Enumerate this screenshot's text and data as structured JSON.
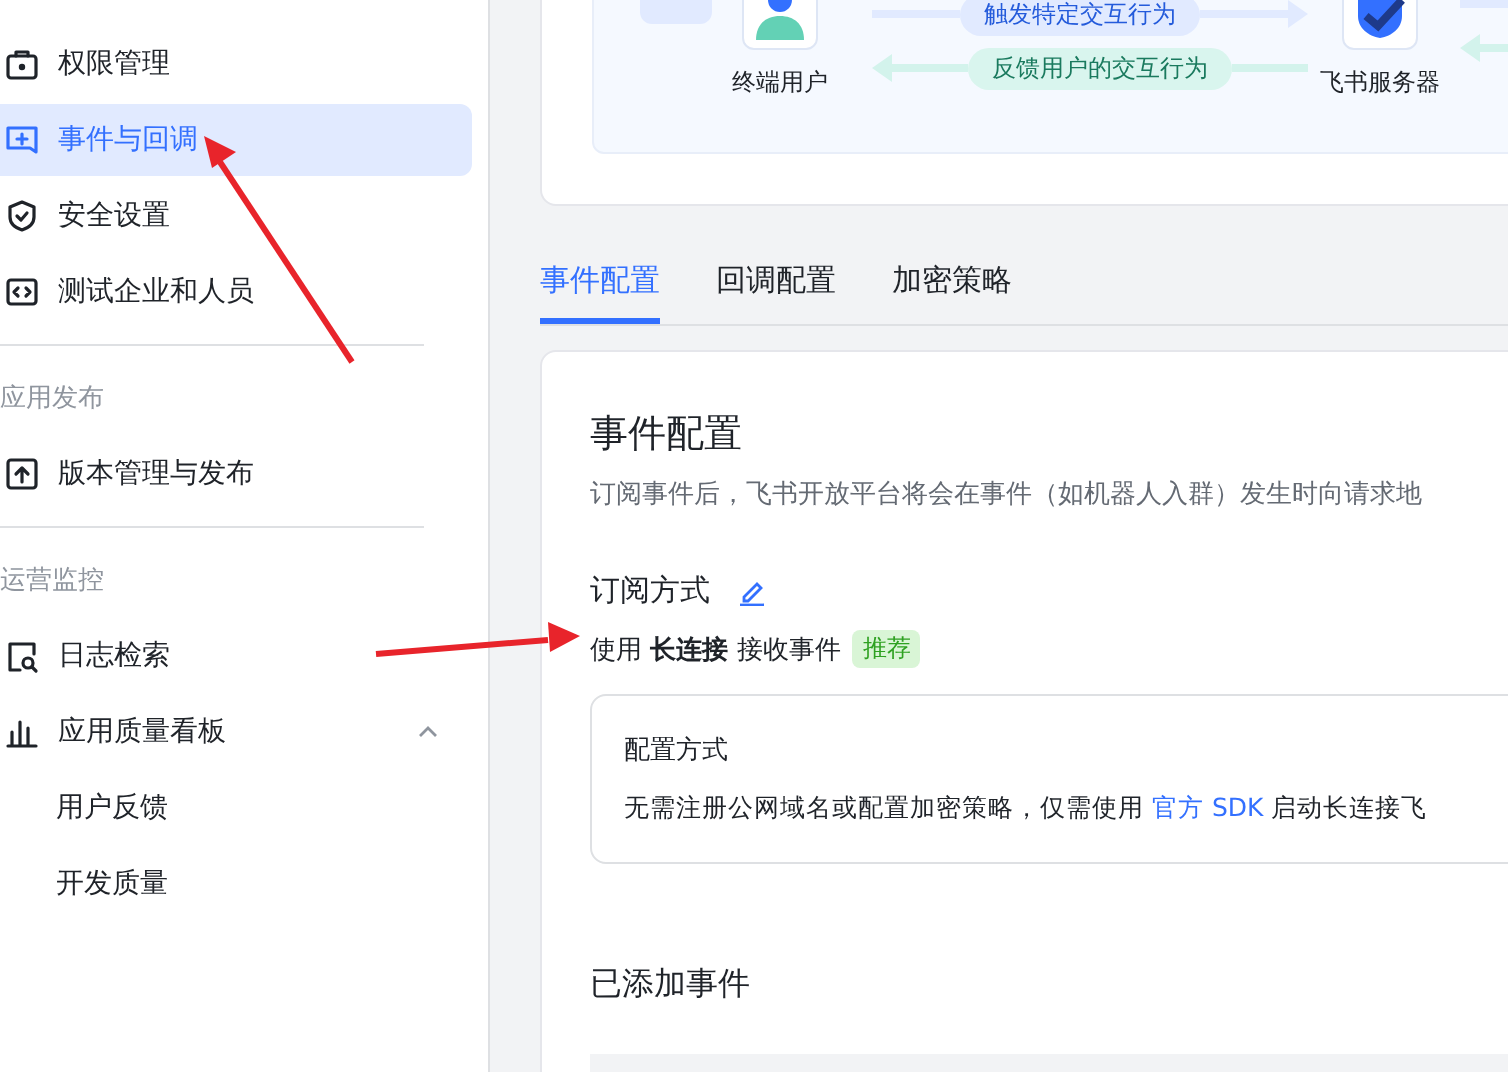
{
  "sidebar": {
    "sections": [
      {
        "items": [
          {
            "label": "权限管理",
            "kind": "lock",
            "selected": false
          },
          {
            "label": "事件与回调",
            "kind": "event",
            "selected": true
          },
          {
            "label": "安全设置",
            "kind": "shield",
            "selected": false
          },
          {
            "label": "测试企业和人员",
            "kind": "code",
            "selected": false
          }
        ]
      },
      {
        "label": "应用发布",
        "items": [
          {
            "label": "版本管理与发布",
            "kind": "upload",
            "selected": false
          }
        ]
      },
      {
        "label": "运营监控",
        "items": [
          {
            "label": "日志检索",
            "kind": "log",
            "selected": false
          },
          {
            "label": "应用质量看板",
            "kind": "chart",
            "selected": false,
            "expanded": true,
            "children": [
              {
                "label": "用户反馈",
                "selected": false
              },
              {
                "label": "开发质量",
                "selected": false
              }
            ]
          }
        ]
      }
    ]
  },
  "diagram": {
    "user_label": "终端用户",
    "server_label": "飞书服务器",
    "flows": [
      {
        "label": "触发特定交互行为",
        "kind": "right"
      },
      {
        "label": "反馈用户的交互行为",
        "kind": "left"
      }
    ]
  },
  "tabs": [
    {
      "label": "事件配置",
      "selected": true
    },
    {
      "label": "回调配置",
      "selected": false
    },
    {
      "label": "加密策略",
      "selected": false
    }
  ],
  "event_config": {
    "title": "事件配置",
    "description": "订阅事件后，飞书开放平台将会在事件（如机器人入群）发生时向请求地",
    "subscription": {
      "heading": "订阅方式",
      "mode": "使用 **长连接** 接收事件",
      "tag": "推荐",
      "config_box": {
        "title": "配置方式",
        "text_before": "无需注册公网域名或配置加密策略，仅需使用 ",
        "link": "官方 SDK",
        "text_after": " 启动长连接飞"
      }
    },
    "added_events_heading": "已添加事件"
  },
  "annotations": [
    {
      "kind": "arrow"
    },
    {
      "kind": "arrow"
    }
  ]
}
